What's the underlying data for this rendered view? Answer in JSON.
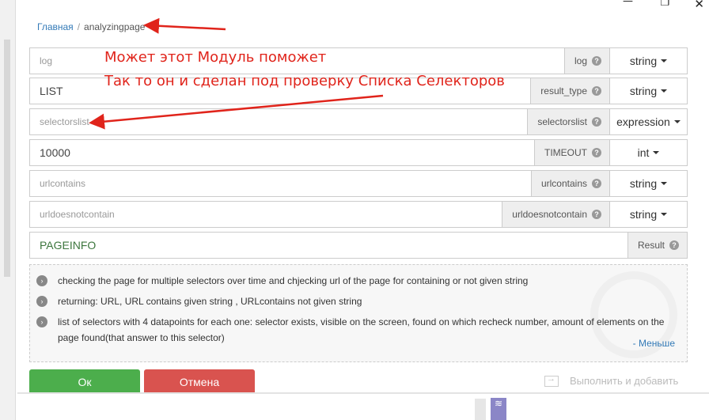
{
  "breadcrumb": {
    "home": "Главная",
    "separator": "/",
    "current": "analyzingpage"
  },
  "rows": [
    {
      "value": "log",
      "is_placeholder": true,
      "label": "log",
      "type": "string"
    },
    {
      "value": "LIST",
      "is_placeholder": false,
      "label": "result_type",
      "type": "string"
    },
    {
      "value": "selectorslist",
      "is_placeholder": true,
      "label": "selectorslist",
      "type": "expression"
    },
    {
      "value": "10000",
      "is_placeholder": false,
      "label": "TIMEOUT",
      "type": "int"
    },
    {
      "value": "urlcontains",
      "is_placeholder": true,
      "label": "urlcontains",
      "type": "string"
    },
    {
      "value": "urldoesnotcontain",
      "is_placeholder": true,
      "label": "urldoesnotcontain",
      "type": "string"
    }
  ],
  "result_row": {
    "value": "PAGEINFO",
    "label": "Result"
  },
  "help_icon": "question-mark-icon",
  "info": {
    "items": [
      "checking the page for multiple selectors over time and chjecking url of the page for containing or not given string",
      "returning: URL, URL contains given string , URLcontains not given string",
      "list of selectors with 4 datapoints for each one: selector exists, visible on the screen, found on which recheck number, amount of elements on the page found(that answer to this selector)"
    ],
    "less_link": "- Меньше"
  },
  "buttons": {
    "ok": "Ок",
    "cancel": "Отмена",
    "execute_add": "Выполнить и добавить"
  },
  "annotations": {
    "line1": "Может этот Модуль поможет",
    "line2": "Так то он и сделан под проверку Списка Селекторов"
  },
  "window": {
    "minimize": "—",
    "maximize": "❐",
    "close": "✕"
  },
  "colors": {
    "ok": "#4cae4c",
    "cancel": "#d9534f",
    "link": "#337ab7",
    "annotation": "#e0241b",
    "result_text": "#3c763d"
  }
}
